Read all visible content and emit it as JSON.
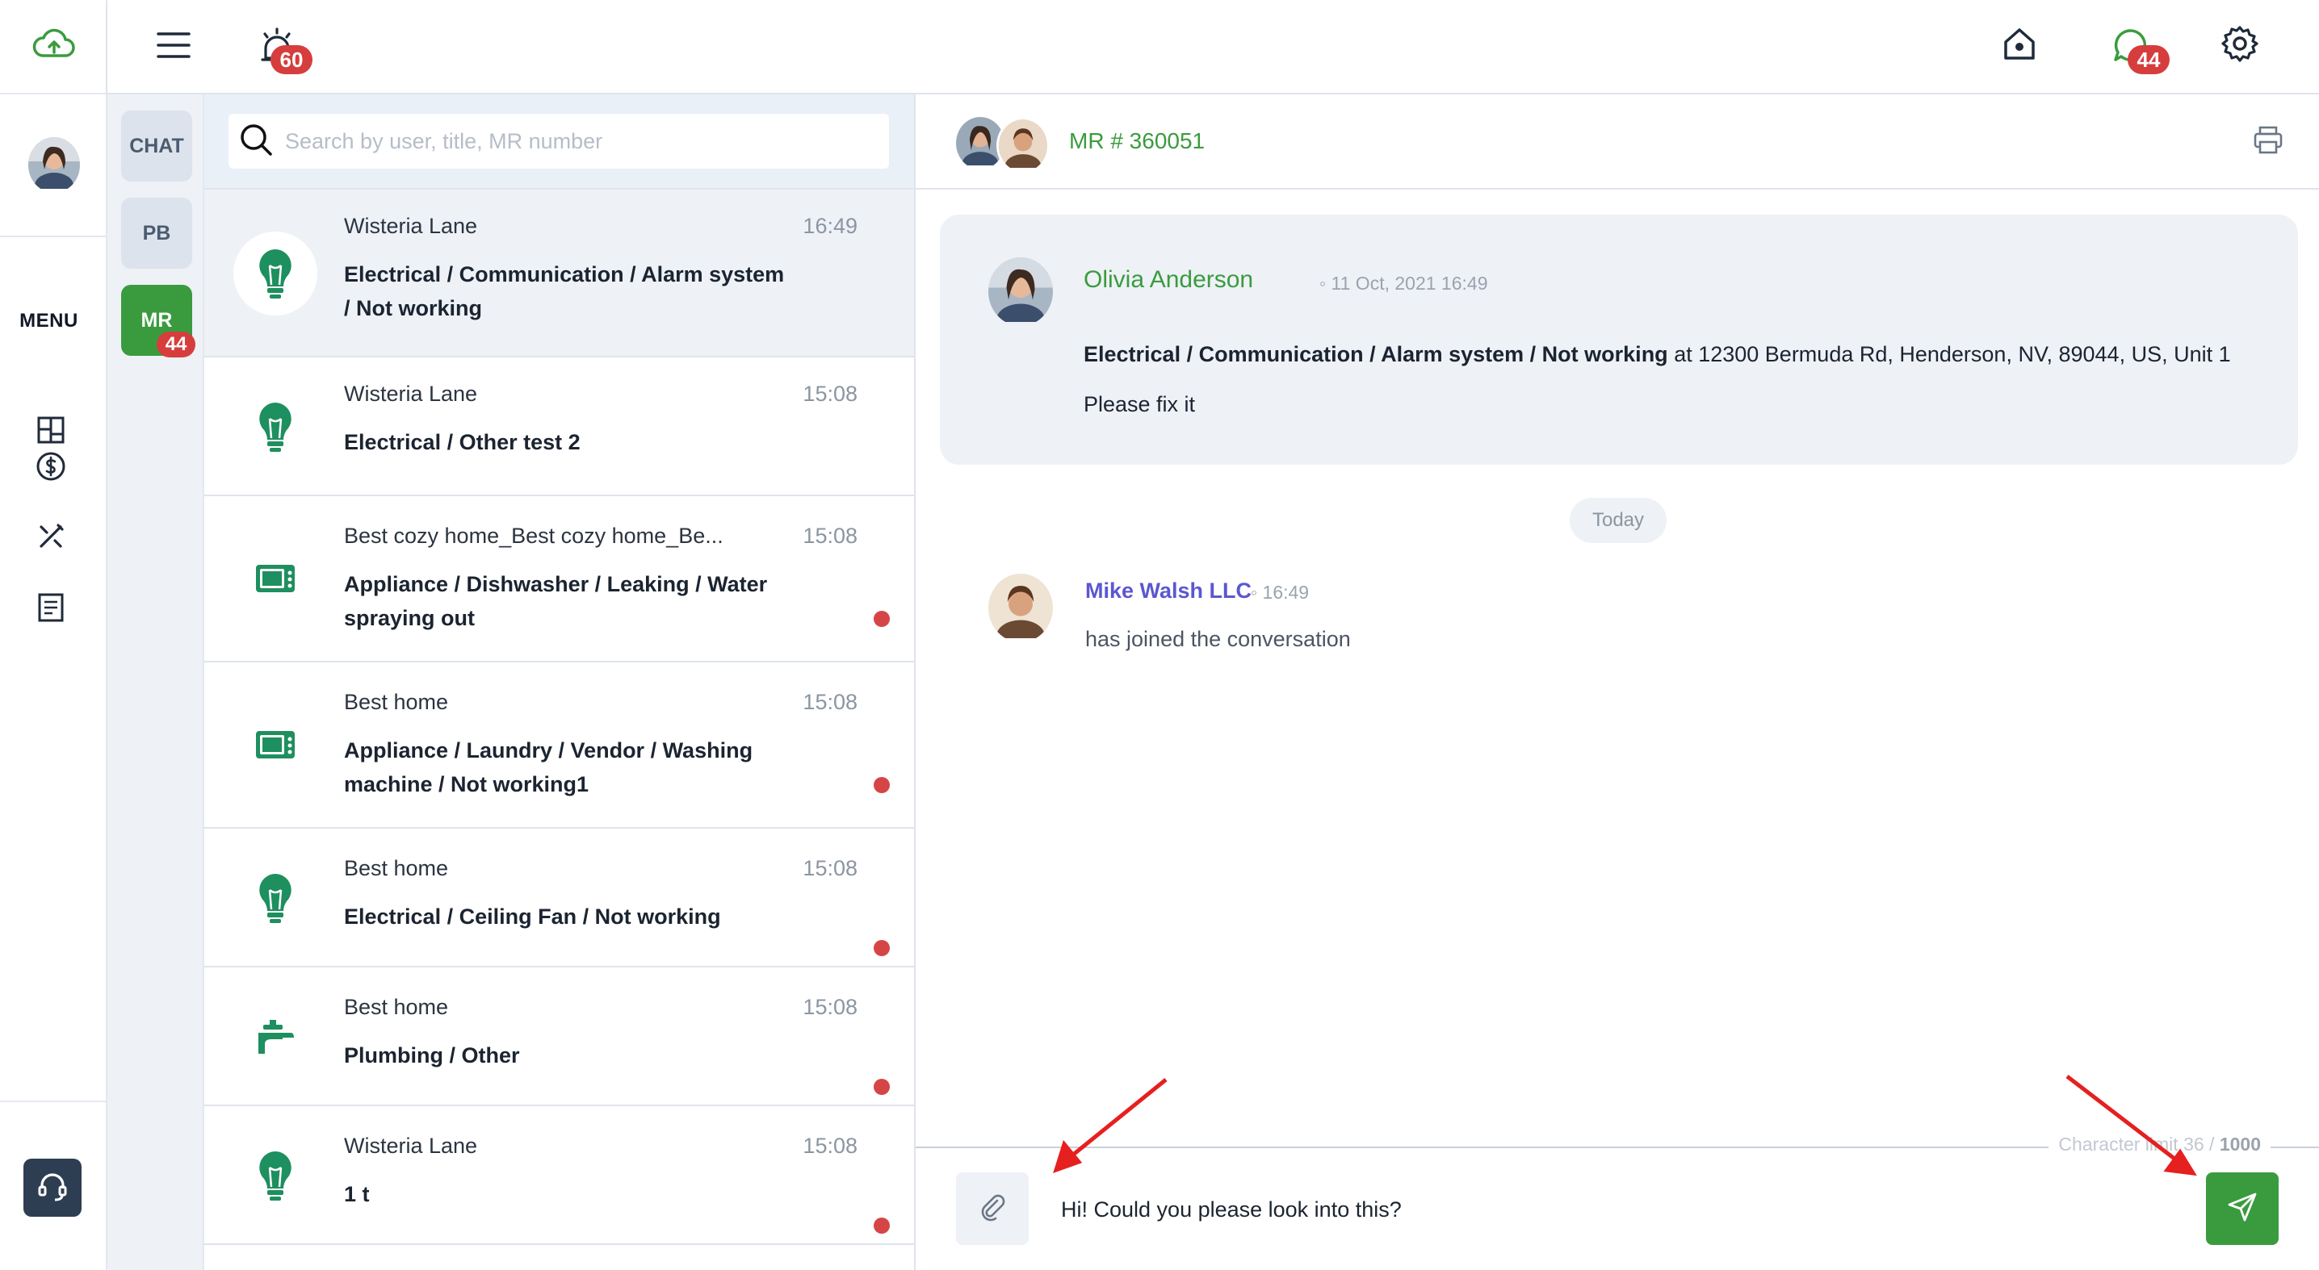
{
  "topbar": {
    "alarm_badge": "60",
    "chat_badge": "44"
  },
  "rail": {
    "menu_label": "MENU",
    "icons": [
      "cloud-upload-icon",
      "dashboard-icon",
      "dollar-icon",
      "tools-icon",
      "document-icon",
      "headset-icon"
    ]
  },
  "categories": {
    "chat": "CHAT",
    "pb": "PB",
    "mr": "MR",
    "mr_badge": "44"
  },
  "search": {
    "placeholder": "Search by user, title, MR number"
  },
  "conversations": [
    {
      "property": "Wisteria Lane",
      "time": "16:49",
      "title": "Electrical / Communication / Alarm system / Not working",
      "icon": "lightbulb-icon",
      "unread": false,
      "selected": true
    },
    {
      "property": "Wisteria Lane",
      "time": "15:08",
      "title": "Electrical / Other test 2",
      "icon": "lightbulb-icon",
      "unread": false,
      "selected": false
    },
    {
      "property": "Best cozy home_Best cozy home_Be...",
      "time": "15:08",
      "title": "Appliance / Dishwasher / Leaking / Water spraying out",
      "icon": "appliance-icon",
      "unread": true,
      "selected": false
    },
    {
      "property": "Best home",
      "time": "15:08",
      "title": "Appliance / Laundry / Vendor / Washing machine / Not working1",
      "icon": "appliance-icon",
      "unread": true,
      "selected": false
    },
    {
      "property": "Best home",
      "time": "15:08",
      "title": "Electrical / Ceiling Fan / Not working",
      "icon": "lightbulb-icon",
      "unread": true,
      "selected": false
    },
    {
      "property": "Best home",
      "time": "15:08",
      "title": "Plumbing / Other",
      "icon": "faucet-icon",
      "unread": true,
      "selected": false
    },
    {
      "property": "Wisteria Lane",
      "time": "15:08",
      "title": "1 t",
      "icon": "lightbulb-icon",
      "unread": true,
      "selected": false
    }
  ],
  "chat": {
    "mr_number": "MR # 360051",
    "message": {
      "author": "Olivia Anderson",
      "meta": "◦ 11 Oct, 2021 16:49",
      "bold_text": "Electrical / Communication / Alarm system / Not working",
      "rest_text": " at 12300 Bermuda Rd, Henderson, NV, 89044, US, Unit 1",
      "second_line": "Please fix it"
    },
    "day_separator": "Today",
    "join": {
      "name": "Mike Walsh LLC",
      "meta": "◦ 16:49",
      "text": "has joined the conversation"
    },
    "composer": {
      "value": "Hi! Could you please look into this?",
      "char_limit_label": "Character limit 36 / ",
      "char_limit_max": "1000"
    }
  },
  "colors": {
    "brand_green": "#3a9b3e",
    "badge_red": "#d63d3d",
    "link_purple": "#5b57d1",
    "icon_green": "#1e8f5e"
  }
}
